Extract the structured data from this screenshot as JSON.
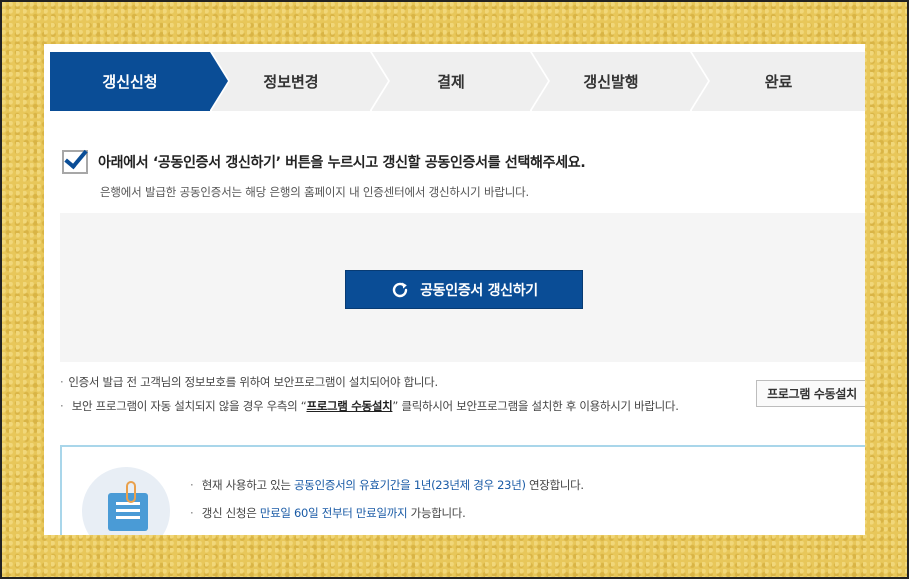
{
  "steps": [
    {
      "label": "갱신신청",
      "active": true
    },
    {
      "label": "정보변경",
      "active": false
    },
    {
      "label": "결제",
      "active": false
    },
    {
      "label": "갱신발행",
      "active": false
    },
    {
      "label": "완료",
      "active": false
    }
  ],
  "notice": {
    "main": "아래에서 ‘공동인증서 갱신하기’ 버튼을 누르시고 갱신할 공동인증서를 선택해주세요.",
    "sub": "은행에서 발급한 공동인증서는 해당 은행의 홈페이지 내 인증센터에서 갱신하시기 바랍니다."
  },
  "renew_button": {
    "label": "공동인증서 갱신하기",
    "icon": "refresh-icon"
  },
  "bullets": {
    "line1": "인증서 발급 전 고객님의 정보보호를 위하여 보안프로그램이 설치되어야 합니다.",
    "line2_pre": "보안 프로그램이 자동 설치되지 않을 경우 우측의 “",
    "line2_em": "프로그램 수동설치",
    "line2_post": "” 클릭하시어 보안프로그램을 설치한 후 이용하시기 바랍니다."
  },
  "manual_install_button": "프로그램 수동설치",
  "info": {
    "line1_pre": "현재 사용하고 있는 ",
    "line1_blue": "공동인증서의 유효기간을 1년(23년제 경우 23년)",
    "line1_post": " 연장합니다.",
    "line2_pre": "갱신 신청은 ",
    "line2_blue": "만료일 60일 전부터 만료일까지",
    "line2_post": " 가능합니다."
  },
  "colors": {
    "accent": "#0a4d96",
    "info_border": "#a9d6ea",
    "background": "#e8c75a"
  }
}
